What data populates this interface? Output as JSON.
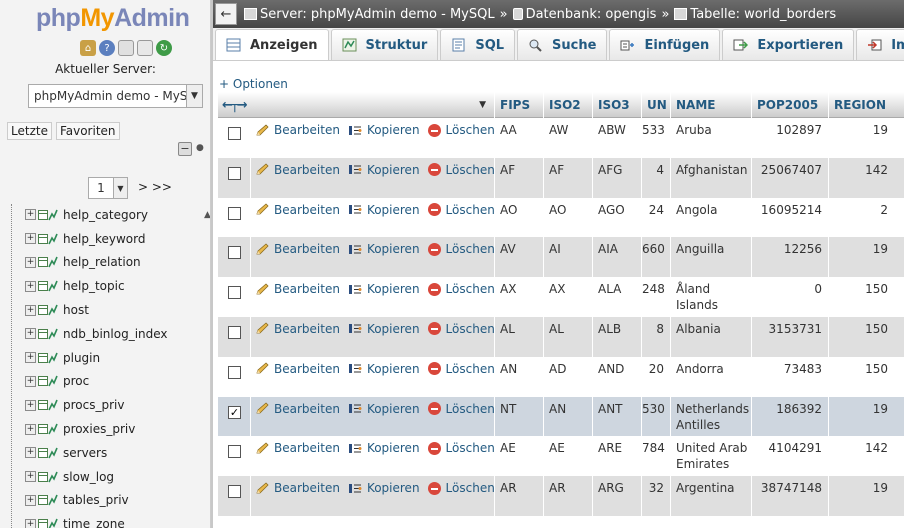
{
  "nav": {
    "logo": {
      "php": "php",
      "my": "My",
      "admin": "Admin"
    },
    "server_label": "Aktueller Server:",
    "server_select": "phpMyAdmin demo - MySQL",
    "tabs": [
      "Letzte",
      "Favoriten"
    ],
    "page_value": "1",
    "page_next": "> >>",
    "tables": [
      "help_category",
      "help_keyword",
      "help_relation",
      "help_topic",
      "host",
      "ndb_binlog_index",
      "plugin",
      "proc",
      "procs_priv",
      "proxies_priv",
      "servers",
      "slow_log",
      "tables_priv",
      "time_zone"
    ]
  },
  "breadcrumb": {
    "server": "Server: phpMyAdmin demo - MySQL",
    "sep": "»",
    "database": "Datenbank: opengis",
    "table": "Tabelle: world_borders"
  },
  "tabs": [
    {
      "label": "Anzeigen",
      "icon": "browse-icon",
      "active": true
    },
    {
      "label": "Struktur",
      "icon": "structure-icon"
    },
    {
      "label": "SQL",
      "icon": "sql-icon"
    },
    {
      "label": "Suche",
      "icon": "search-icon"
    },
    {
      "label": "Einfügen",
      "icon": "insert-icon"
    },
    {
      "label": "Exportieren",
      "icon": "export-icon"
    },
    {
      "label": "Importieren",
      "icon": "import-icon"
    }
  ],
  "options_link": "+ Optionen",
  "actions": {
    "edit": "Bearbeiten",
    "copy": "Kopieren",
    "delete": "Löschen"
  },
  "columns": [
    "FIPS",
    "ISO2",
    "ISO3",
    "UN",
    "NAME",
    "POP2005",
    "REGION"
  ],
  "rows": [
    {
      "fips": "AA",
      "iso2": "AW",
      "iso3": "ABW",
      "un": "533",
      "name": "Aruba",
      "pop": "102897",
      "region": "19",
      "checked": false
    },
    {
      "fips": "AF",
      "iso2": "AF",
      "iso3": "AFG",
      "un": "4",
      "name": "Afghanistan",
      "pop": "25067407",
      "region": "142",
      "checked": false
    },
    {
      "fips": "AO",
      "iso2": "AO",
      "iso3": "AGO",
      "un": "24",
      "name": "Angola",
      "pop": "16095214",
      "region": "2",
      "checked": false
    },
    {
      "fips": "AV",
      "iso2": "AI",
      "iso3": "AIA",
      "un": "660",
      "name": "Anguilla",
      "pop": "12256",
      "region": "19",
      "checked": false
    },
    {
      "fips": "AX",
      "iso2": "AX",
      "iso3": "ALA",
      "un": "248",
      "name": "Åland Islands",
      "pop": "0",
      "region": "150",
      "checked": false
    },
    {
      "fips": "AL",
      "iso2": "AL",
      "iso3": "ALB",
      "un": "8",
      "name": "Albania",
      "pop": "3153731",
      "region": "150",
      "checked": false
    },
    {
      "fips": "AN",
      "iso2": "AD",
      "iso3": "AND",
      "un": "20",
      "name": "Andorra",
      "pop": "73483",
      "region": "150",
      "checked": false
    },
    {
      "fips": "NT",
      "iso2": "AN",
      "iso3": "ANT",
      "un": "530",
      "name": "Netherlands Antilles",
      "pop": "186392",
      "region": "19",
      "checked": true
    },
    {
      "fips": "AE",
      "iso2": "AE",
      "iso3": "ARE",
      "un": "784",
      "name": "United Arab Emirates",
      "pop": "4104291",
      "region": "142",
      "checked": false
    },
    {
      "fips": "AR",
      "iso2": "AR",
      "iso3": "ARG",
      "un": "32",
      "name": "Argentina",
      "pop": "38747148",
      "region": "19",
      "checked": false
    }
  ]
}
